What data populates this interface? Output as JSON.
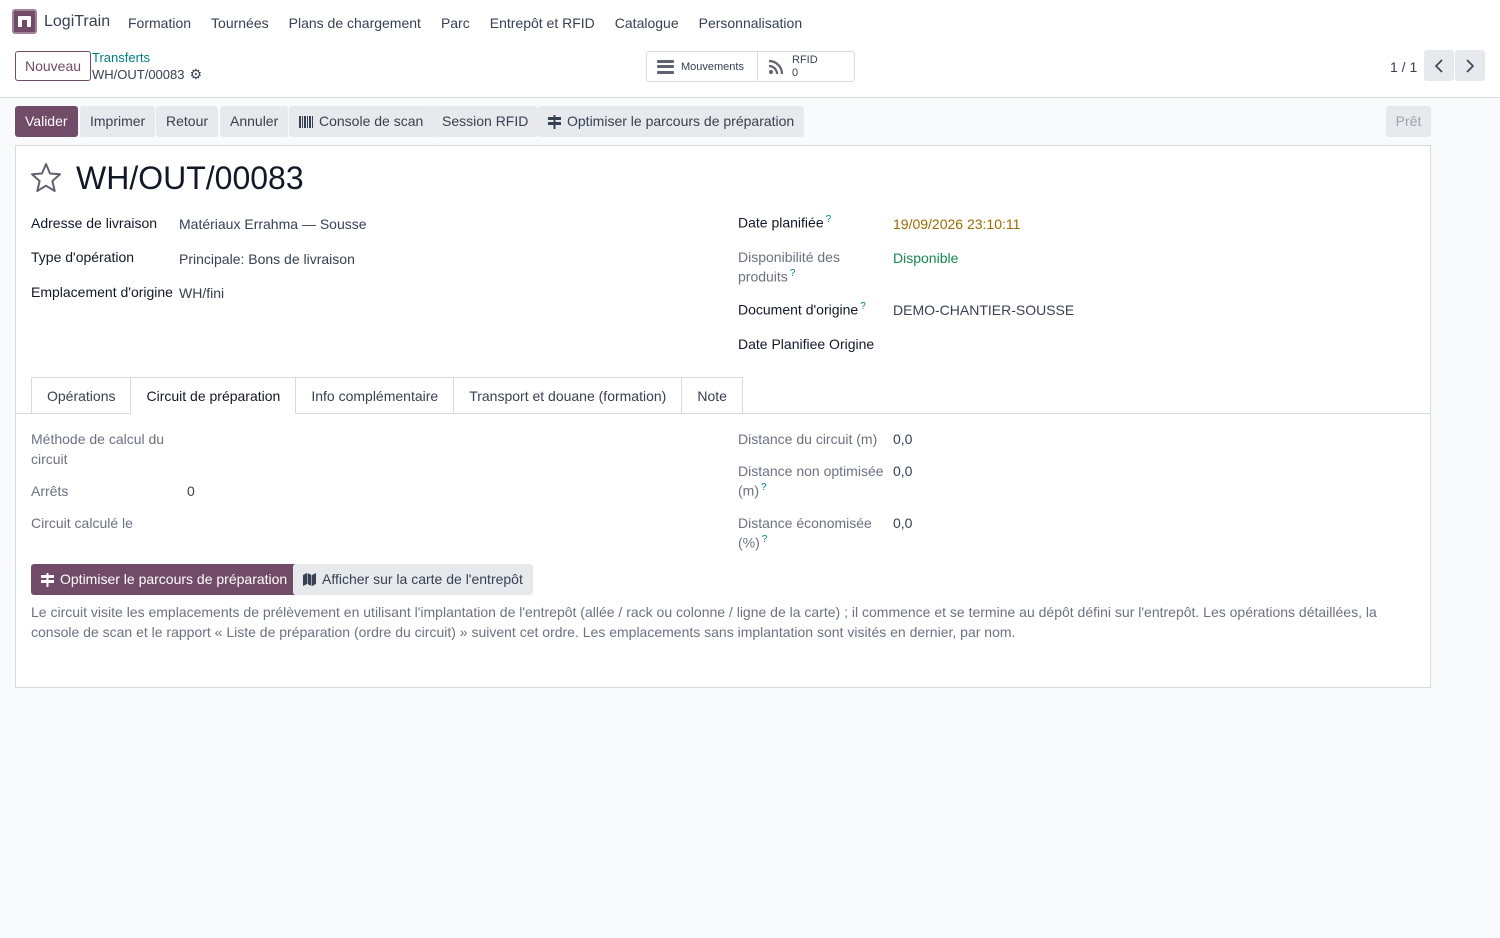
{
  "app": {
    "name": "LogiTrain",
    "menu": [
      "Formation",
      "Tournées",
      "Plans de chargement",
      "Parc",
      "Entrepôt et RFID",
      "Catalogue",
      "Personnalisation"
    ]
  },
  "control_panel": {
    "new_button": "Nouveau",
    "breadcrumb_parent": "Transferts",
    "breadcrumb_current": "WH/OUT/00083",
    "smart_buttons": {
      "mouvements": "Mouvements",
      "rfid_label": "RFID",
      "rfid_count": "0"
    },
    "pager": "1 / 1"
  },
  "status_bar": {
    "buttons": [
      "Valider",
      "Imprimer",
      "Retour",
      "Annuler",
      "Console de scan",
      "Session RFID",
      "Optimiser le parcours de préparation"
    ],
    "state": "Prêt"
  },
  "record": {
    "title": "WH/OUT/00083",
    "fields_left": [
      {
        "label": "Adresse de livraison",
        "value": "Matériaux Errahma — Sousse"
      },
      {
        "label": "Type d'opération",
        "value": "Principale: Bons de livraison"
      },
      {
        "label": "Emplacement d'origine",
        "value": "WH/fini"
      }
    ],
    "fields_right": {
      "date_planifiee_label": "Date planifiée",
      "date_planifiee_value": "19/09/2026 23:10:11",
      "dispo_label_1": "Disponibilité des",
      "dispo_label_2": "produits",
      "dispo_value": "Disponible",
      "doc_origine_label": "Document d'origine",
      "doc_origine_value": "DEMO-CHANTIER-SOUSSE",
      "date_origine_label": "Date Planifiee Origine"
    },
    "tooltip_mark": "?"
  },
  "tabs": [
    "Opérations",
    "Circuit de préparation",
    "Info complémentaire",
    "Transport et douane (formation)",
    "Note"
  ],
  "circuit": {
    "methode_label_1": "Méthode de calcul du",
    "methode_label_2": "circuit",
    "arrets_label": "Arrêts",
    "arrets_value": "0",
    "calcule_label": "Circuit calculé le",
    "distance_label": "Distance du circuit (m)",
    "distance_value": "0,0",
    "non_opt_label_1": "Distance non optimisée",
    "non_opt_label_2": "(m)",
    "non_opt_value": "0,0",
    "econ_label_1": "Distance économisée",
    "econ_label_2": "(%)",
    "econ_value": "0,0",
    "optimize_button": "Optimiser le parcours de préparation",
    "map_button": "Afficher sur la carte de l'entrepôt",
    "help_text": "Le circuit visite les emplacements de prélèvement en utilisant l'implantation de l'entrepôt (allée / rack ou colonne / ligne de la carte) ; il commence et se termine au dépôt défini sur l'entrepôt. Les opérations détaillées, la console de scan et le rapport « Liste de préparation (ordre du circuit) » suivent cet ordre. Les emplacements sans implantation sont visités en dernier, par nom."
  },
  "colors": {
    "brand": "#714b67",
    "link": "#017e84",
    "date_warning": "#9a6b01",
    "success": "#198754"
  }
}
